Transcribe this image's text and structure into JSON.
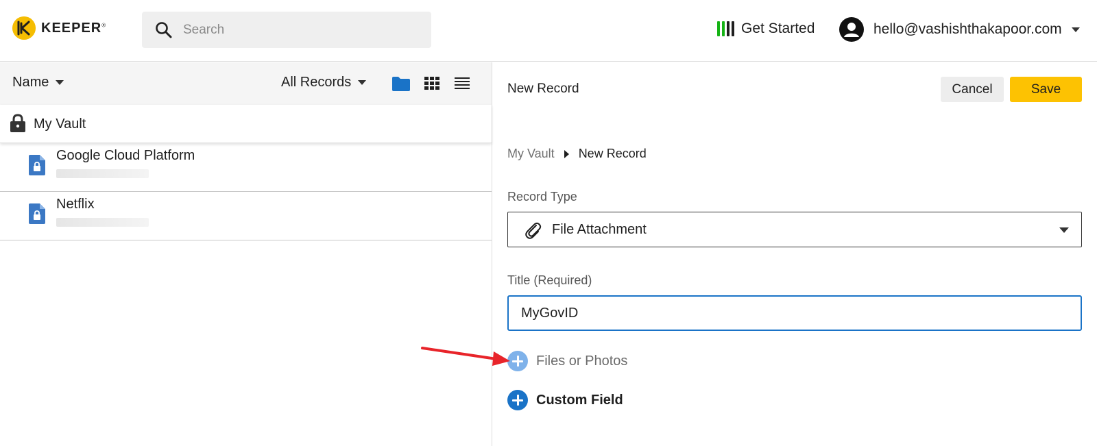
{
  "header": {
    "logo_text": "KEEPER",
    "logo_mark": "®",
    "search_placeholder": "Search",
    "get_started_label": "Get Started",
    "account_email": "hello@vashishthakapoor.com"
  },
  "list_panel": {
    "sort_label": "Name",
    "filter_label": "All Records",
    "vault_label": "My Vault",
    "records": [
      {
        "title": "Google Cloud Platform"
      },
      {
        "title": "Netflix"
      }
    ]
  },
  "record_editor": {
    "heading": "New Record",
    "cancel_label": "Cancel",
    "save_label": "Save",
    "breadcrumb": [
      "My Vault",
      "New Record"
    ],
    "record_type_label": "Record Type",
    "record_type_value": "File Attachment",
    "title_label": "Title (Required)",
    "title_value": "MyGovID",
    "files_label": "Files or Photos",
    "custom_field_label": "Custom Field"
  },
  "colors": {
    "brand_yellow": "#fdc202",
    "accent_blue": "#1a73c7",
    "light_blue": "#7fb2ea",
    "annotation_red": "#e8242a",
    "progress_green": "#15b315"
  }
}
